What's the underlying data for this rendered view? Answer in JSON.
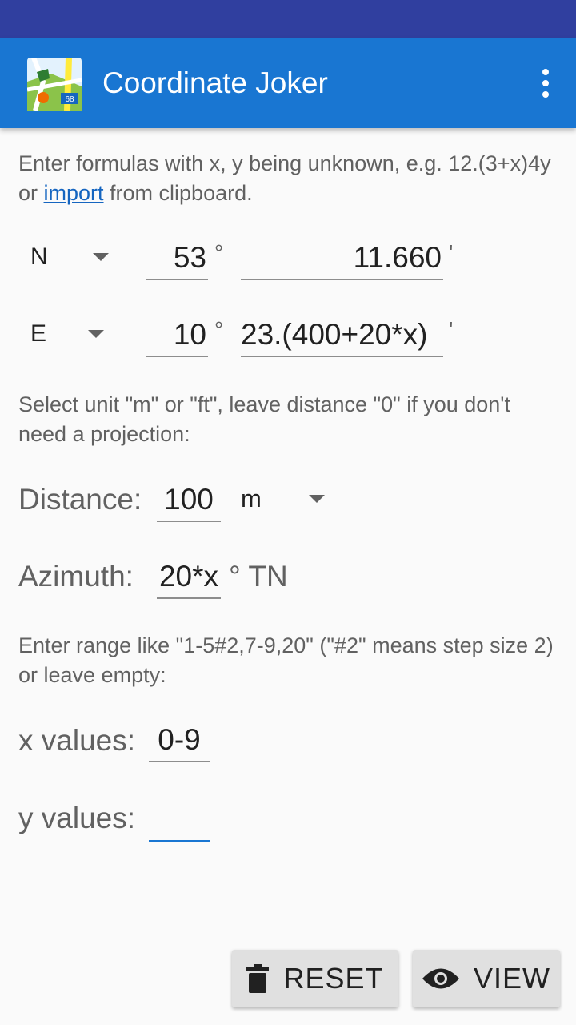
{
  "app": {
    "title": "Coordinate Joker"
  },
  "hints": {
    "formula_pre": "Enter formulas with x, y being unknown, e.g. 12.(3+x)4y or ",
    "formula_link": "import",
    "formula_post": " from clipboard.",
    "distance": "Select unit \"m\" or \"ft\", leave distance \"0\" if you don't need a projection:",
    "range": "Enter range like \"1-5#2,7-9,20\" (\"#2\" means step size 2) or leave empty:"
  },
  "coords": {
    "north": {
      "dir": "N",
      "degrees": "53",
      "minutes": "11.660"
    },
    "east": {
      "dir": "E",
      "degrees": "10",
      "minutes": "23.(400+20*x)"
    },
    "degree_symbol": "°",
    "minute_symbol": "'"
  },
  "distance": {
    "label": "Distance:",
    "value": "100",
    "unit": "m"
  },
  "azimuth": {
    "label": "Azimuth:",
    "value": "20*x",
    "unit": "° TN"
  },
  "x_values": {
    "label": "x values:",
    "value": "0-9"
  },
  "y_values": {
    "label": "y values:",
    "value": ""
  },
  "buttons": {
    "reset": "RESET",
    "view": "VIEW"
  },
  "colors": {
    "status_bar": "#303f9f",
    "app_bar": "#1976d2",
    "accent": "#1976d2"
  }
}
